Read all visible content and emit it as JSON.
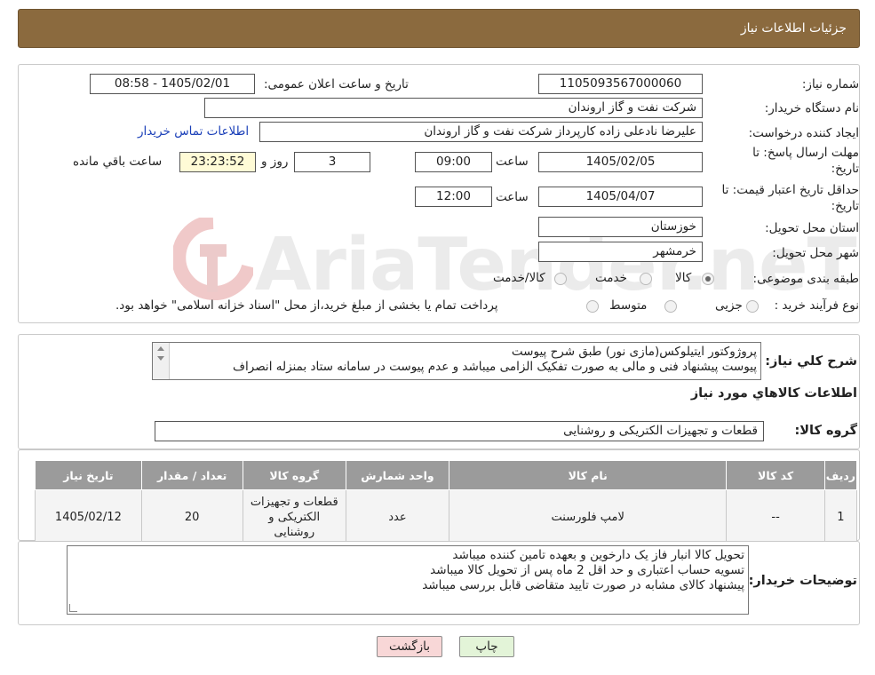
{
  "header": {
    "title": "جزئیات اطلاعات نیاز"
  },
  "form": {
    "need_number": {
      "label": "شماره نیاز:",
      "value": "1105093567000060"
    },
    "announce_datetime": {
      "label": "تاریخ و ساعت اعلان عمومی:",
      "value": "1405/02/01 - 08:58"
    },
    "buyer_org": {
      "label": "نام دستگاه خریدار:",
      "value": "شرکت نفت و گاز اروندان"
    },
    "requester": {
      "label": "ایجاد کننده درخواست:",
      "value": "علیرضا نادعلی زاده کارپرداز شرکت نفت و گاز اروندان",
      "contact_link": "اطلاعات تماس خریدار"
    },
    "reply_deadline": {
      "label_line1": "مهلت ارسال پاسخ: تا",
      "label_line2": "تاریخ:",
      "date": "1405/02/05",
      "time_label": "ساعت",
      "time": "09:00",
      "days": "3",
      "days_label": "روز و",
      "remaining": "23:23:52",
      "remaining_label": "ساعت باقي مانده"
    },
    "price_validity": {
      "label_line1": "حداقل تاریخ اعتبار قیمت: تا",
      "label_line2": "تاریخ:",
      "date": "1405/04/07",
      "time_label": "ساعت",
      "time": "12:00"
    },
    "province": {
      "label": "استان محل تحویل:",
      "value": "خوزستان"
    },
    "city": {
      "label": "شهر محل تحویل:",
      "value": "خرمشهر"
    },
    "category": {
      "label": "طبقه بندی موضوعی:",
      "options": [
        "کالا",
        "خدمت",
        "کالا/خدمت"
      ],
      "selected": "کالا"
    },
    "purchase_type": {
      "label": "نوع فرآیند خرید :",
      "options": [
        "جزیی",
        "متوسط"
      ],
      "note": "پرداخت تمام یا بخشی از مبلغ خرید،از محل \"اسناد خزانه اسلامی\" خواهد بود."
    }
  },
  "watermark": {
    "text": "AriaTender.neT"
  },
  "description": {
    "label": "شرح کلي نیاز:",
    "lines": [
      "پروژوکتور ایتیلوکس(مازی نور) طبق شرح پیوست",
      "پیوست پیشنهاد فنی و مالی به صورت تفکیک الزامی میباشد و عدم پیوست در سامانه ستاد بمنزله انصراف"
    ]
  },
  "goods_info": {
    "title": "اطلاعات کالاهاي مورد نياز",
    "group_label": "گروه کالا:",
    "group_value": "قطعات و تجهیزات الکتریکی و روشنایی"
  },
  "table": {
    "headers": [
      "ردیف",
      "کد کالا",
      "نام کالا",
      "واحد شمارش",
      "گروه کالا",
      "تعداد / مقدار",
      "تاریخ نیاز"
    ],
    "rows": [
      {
        "row": "1",
        "code": "--",
        "name": "لامپ فلورسنت",
        "unit": "عدد",
        "group": "قطعات و تجهیزات الکتریکی و روشنایی",
        "qty": "20",
        "date": "1405/02/12"
      }
    ]
  },
  "buyer_notes": {
    "label": "توضیحات خریدار:",
    "lines": [
      "تحویل کالا انبار فاز یک دارخوین و بعهده تامین کننده میباشد",
      "تسویه حساب اعتباری و حد اقل 2 ماه پس از تحویل کالا میباشد",
      "پیشنهاد کالای مشابه در صورت تایید متقاضی قابل بررسی میباشد"
    ]
  },
  "buttons": {
    "print": "چاپ",
    "back": "بازگشت"
  },
  "colors": {
    "header_bg": "#8b6a3e",
    "table_header_bg": "#9b9b9b",
    "back_button_bg": "#f8d7d7",
    "print_button_bg": "#e3f4d8",
    "remaining_bg": "#fffbd6"
  }
}
